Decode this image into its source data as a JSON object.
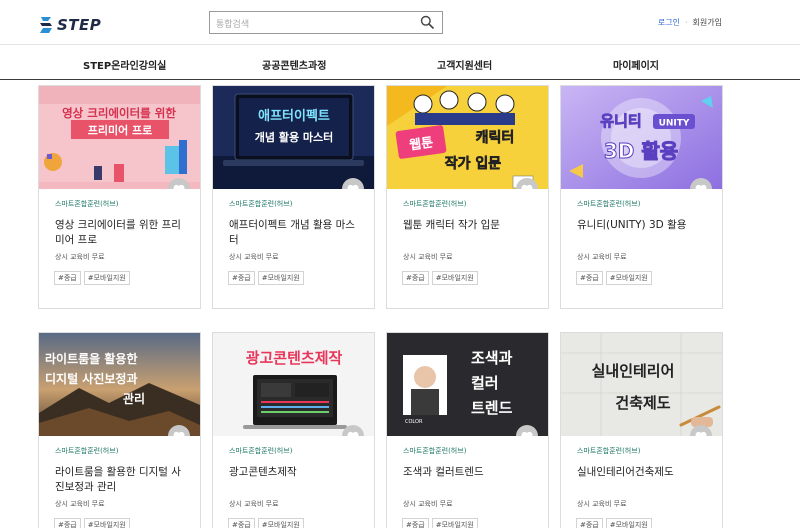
{
  "header": {
    "logo_text": "STEP",
    "search_placeholder": "통합검색",
    "login_label": "로그인",
    "separator": "·",
    "signup_label": "회원가입"
  },
  "nav": {
    "items": [
      {
        "label": "STEP온라인강의실"
      },
      {
        "label": "공공콘텐츠과정"
      },
      {
        "label": "고객지원센터"
      },
      {
        "label": "마이페이지"
      }
    ]
  },
  "courses": [
    {
      "provider": "스마트혼합훈련(허브)",
      "title": "영상 크리에이터를 위한 프리미어 프로",
      "cost": "상시 교육비 무료",
      "tags": [
        "#중급",
        "#모바일지원"
      ],
      "thumb": {
        "line1": "영상 크리에이터를 위한",
        "line2": "프리미어 프로",
        "bg": "#f6c5cb",
        "accent": "#e8536a"
      }
    },
    {
      "provider": "스마트혼합훈련(허브)",
      "title": "애프터이펙트 개념 활용 마스터",
      "cost": "상시 교육비 무료",
      "tags": [
        "#중급",
        "#모바일지원"
      ],
      "thumb": {
        "line1": "애프터이펙트",
        "line2": "개념 활용 마스터",
        "bg": "#1c2a5a",
        "accent": "#3fd0ff"
      }
    },
    {
      "provider": "스마트혼합훈련(허브)",
      "title": "웹툰 캐릭터 작가 입문",
      "cost": "상시 교육비 무료",
      "tags": [
        "#중급",
        "#모바일지원"
      ],
      "thumb": {
        "line1": "웹툰 캐릭터",
        "line2": "작가 입문",
        "bg": "#f7d13b",
        "accent": "#ee3f7c"
      }
    },
    {
      "provider": "스마트혼합훈련(허브)",
      "title": "유니티(UNITY) 3D 활용",
      "cost": "상시 교육비 무료",
      "tags": [
        "#중급",
        "#모바일지원"
      ],
      "thumb": {
        "line1": "유니티",
        "badge": "UNITY",
        "line2": "3D 활용",
        "bg": "#a98ee8",
        "accent": "#6a4fd0"
      }
    },
    {
      "provider": "스마트혼합훈련(허브)",
      "title": "라이트룸을 활용한 디지털 사진보정과 관리",
      "cost": "상시 교육비 무료",
      "tags": [
        "#중급",
        "#모바일지원"
      ],
      "thumb": {
        "line1": "라이트룸을 활용한",
        "line2": "디지털 사진보정과",
        "line3": "관리",
        "bg": "#3c4a5e",
        "accent": "#e9a74a"
      }
    },
    {
      "provider": "스마트혼합훈련(허브)",
      "title": "광고콘텐츠제작",
      "cost": "상시 교육비 무료",
      "tags": [
        "#중급",
        "#모바일지원"
      ],
      "thumb": {
        "line1": "광고콘텐츠제작",
        "bg": "#f4f4f4",
        "accent": "#e8365a"
      }
    },
    {
      "provider": "스마트혼합훈련(허브)",
      "title": "조색과 컬러트렌드",
      "cost": "상시 교육비 무료",
      "tags": [
        "#중급",
        "#모바일지원"
      ],
      "thumb": {
        "line1": "조색과",
        "line2": "컬러",
        "line3": "트렌드",
        "bg": "#2a2a2e",
        "accent": "#ffffff"
      }
    },
    {
      "provider": "스마트혼합훈련(허브)",
      "title": "실내인테리어건축제도",
      "cost": "상시 교육비 무료",
      "tags": [
        "#중급",
        "#모바일지원"
      ],
      "thumb": {
        "line1": "실내인테리어",
        "line2": "건축제도",
        "bg": "#e8e8e4",
        "accent": "#222222"
      }
    }
  ]
}
